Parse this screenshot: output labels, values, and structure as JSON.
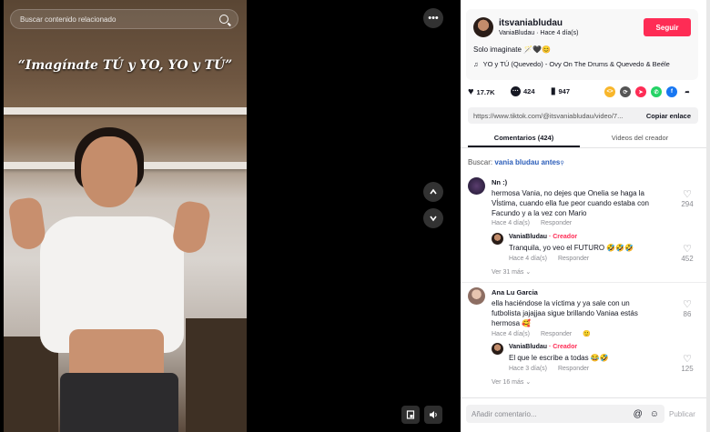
{
  "video": {
    "search_placeholder": "Buscar contenido relacionado",
    "overlay_text": "“Imagínate TÚ y YO, YO y TÚ”"
  },
  "author": {
    "username": "itsvaniabludau",
    "subline": "VaniaBludau · Hace 4 día(s)",
    "follow_label": "Seguir",
    "caption": "Solo imaginate 🪄🖤😊",
    "music": "YO y TÚ (Quevedo) - Ovy On The Drums & Quevedo & Beéle"
  },
  "stats": {
    "likes": "17.7K",
    "comments": "424",
    "saves": "947"
  },
  "link": {
    "url": "https://www.tiktok.com/@itsvaniabludau/video/7...",
    "copy_label": "Copiar enlace"
  },
  "tabs": {
    "comments": "Comentarios (424)",
    "creator": "Videos del creador"
  },
  "search_hint": {
    "label": "Buscar:",
    "term": "vania bludau antes"
  },
  "comments": [
    {
      "name": "Nn :)",
      "text": [
        "hermosa Vania, no dejes que Onelia se haga la",
        "Vĺstima, cuando ella fue peor cuando estaba con",
        "Facundo y a la vez con Mario"
      ],
      "meta": "Hace 4 día(s)",
      "reply_label": "Responder",
      "likes": "294",
      "reply": {
        "name": "VaniaBludau",
        "creator_tag": " · Creador",
        "text": "Tranquila, yo veo el FUTURO 🤣🤣🤣",
        "meta": "Hace 4 día(s)",
        "reply_label": "Responder",
        "likes": "452"
      },
      "more": "Ver 31 más"
    },
    {
      "name": "Ana Lu Garcia",
      "text": [
        "ella haciéndose la víctima y ya sale con un",
        "futbolista jajajjaa sigue brillando Vaniaa estás",
        "hermosa 🥰"
      ],
      "meta": "Hace 4 día(s)",
      "reply_label": "Responder",
      "likes": "86",
      "reply": {
        "name": "VaniaBludau",
        "creator_tag": " · Creador",
        "text": "El que le escribe a todas 😂🤣",
        "meta": "Hace 3 día(s)",
        "reply_label": "Responder",
        "likes": "125"
      },
      "more": "Ver 16 más"
    }
  ],
  "input": {
    "placeholder": "Añadir comentario...",
    "publish": "Publicar"
  },
  "colors": {
    "accent": "#fe2c55",
    "creator": "#fe2c55",
    "search_term": "#2b5db9"
  }
}
